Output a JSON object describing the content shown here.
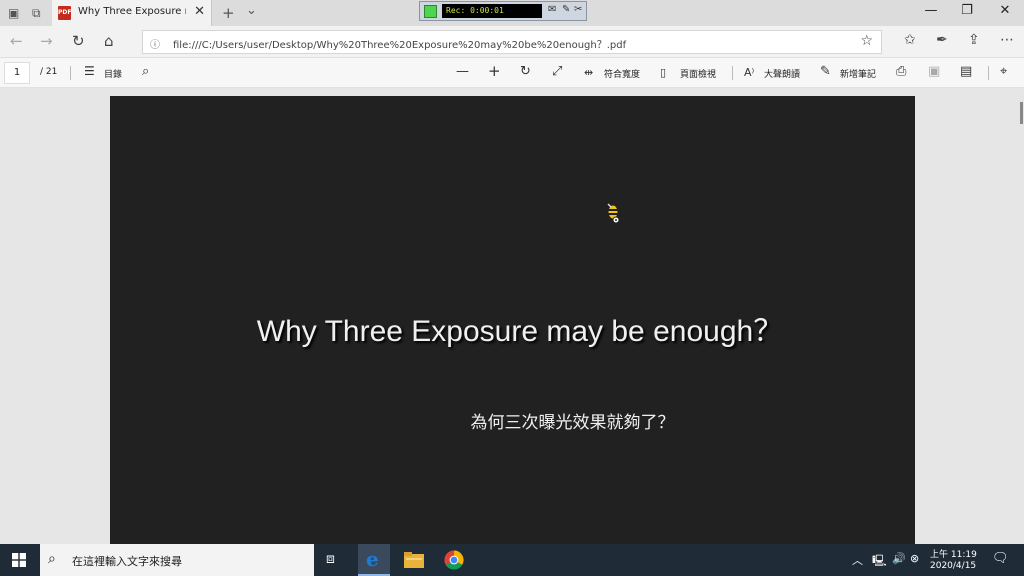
{
  "browser": {
    "tab_title": "Why Three Exposure ma",
    "tab_close": "✕",
    "new_tab": "+",
    "tab_menu": "⌄",
    "pdf_badge": "PDF",
    "url": "file:///C:/Users/user/Desktop/Why%20Three%20Exposure%20may%20be%20enough？.pdf",
    "window": {
      "minimize": "—",
      "maximize": "❐",
      "close": "✕"
    }
  },
  "recorder": {
    "time": "Rec: 0:00:01"
  },
  "pdf_toolbar": {
    "current_page": "1",
    "total_pages": "/ 21",
    "contents_label": "目錄",
    "fit_width_label": "符合寬度",
    "page_view_label": "頁面檢視",
    "read_aloud_label": "大聲朗讀",
    "add_notes_label": "新增筆記"
  },
  "document": {
    "title": "Why Three Exposure may be enough？",
    "subtitle": "為何三次曝光效果就夠了？"
  },
  "taskbar": {
    "search_placeholder": "在這裡輸入文字來搜尋",
    "time": "上午 11:19",
    "date": "2020/4/15"
  },
  "colors": {
    "page_background": "#212121",
    "taskbar": "#1f2b36",
    "recorder_indicator": "#4fd44f",
    "edge_blue": "#1e7bd6"
  }
}
